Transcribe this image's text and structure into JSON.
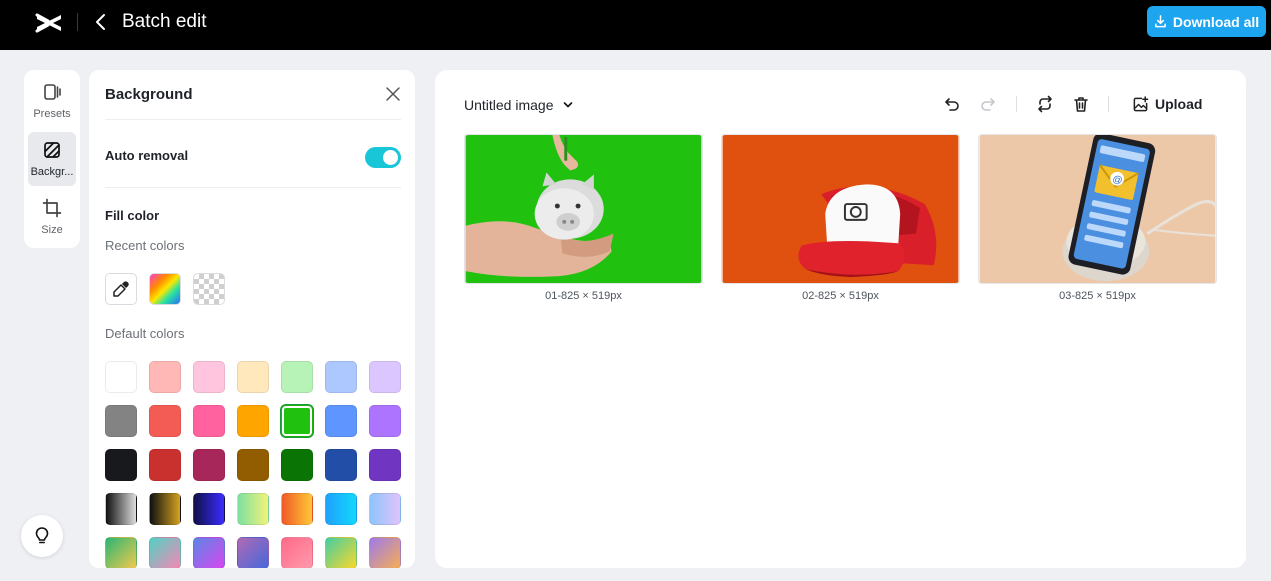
{
  "app": {
    "title": "Batch edit",
    "download_label": "Download all",
    "accent": "#1ea5f0"
  },
  "rail": {
    "items": [
      {
        "label": "Presets",
        "icon": "presets-icon"
      },
      {
        "label": "Backgr...",
        "icon": "background-icon",
        "active": true
      },
      {
        "label": "Size",
        "icon": "crop-icon"
      }
    ]
  },
  "panel": {
    "title": "Background",
    "auto_removal_label": "Auto removal",
    "auto_removal_on": true,
    "fill_color_label": "Fill color",
    "recent_colors_label": "Recent colors",
    "default_colors_label": "Default colors",
    "recent_swatches": [
      "eyedropper",
      "rainbow-gradient",
      "transparent"
    ],
    "default_swatches": [
      [
        "#ffffff",
        "#ffb8b5",
        "#ffc4de",
        "#ffe8bc",
        "#b7f2b6",
        "#adc8ff",
        "#dcc6ff"
      ],
      [
        "#838383",
        "#f25c55",
        "#ff629f",
        "#ffa500",
        "#20c20f",
        "#5f95ff",
        "#ad75ff"
      ],
      [
        "#18191d",
        "#c9312f",
        "#a7275a",
        "#915d00",
        "#0a7504",
        "#224ea8",
        "#7136c1"
      ],
      [
        "linear-gradient(90deg,#111,#ddd)",
        "linear-gradient(90deg,#111,#d4a21e)",
        "linear-gradient(90deg,#10104a,#3b2cff)",
        "linear-gradient(90deg,#7ce0a0,#f3f27a)",
        "linear-gradient(90deg,#f05a28,#ffc837)",
        "linear-gradient(90deg,#1fa2ff,#12d8fa)",
        "linear-gradient(90deg,#8ec5fc,#e0c3fc)"
      ],
      [
        "linear-gradient(135deg,#2bb673,#f2c94c)",
        "linear-gradient(135deg,#4fd1c5,#f687b3)",
        "linear-gradient(135deg,#5b86e5,#d946ef)",
        "linear-gradient(135deg,#b06ab3,#4568dc)",
        "linear-gradient(135deg,#ff6a88,#ff99ac)",
        "linear-gradient(135deg,#43cea2,#fbd72b)",
        "linear-gradient(135deg,#9f7aea,#f6ad55)"
      ]
    ],
    "selected_swatch": "#20c20f"
  },
  "main": {
    "doc_title": "Untitled image",
    "upload_label": "Upload",
    "images": [
      {
        "caption": "01-825 × 519px",
        "background": "#20c20f"
      },
      {
        "caption": "02-825 × 519px",
        "background": "#e0500f"
      },
      {
        "caption": "03-825 × 519px",
        "background": "#edc8a8"
      }
    ]
  }
}
